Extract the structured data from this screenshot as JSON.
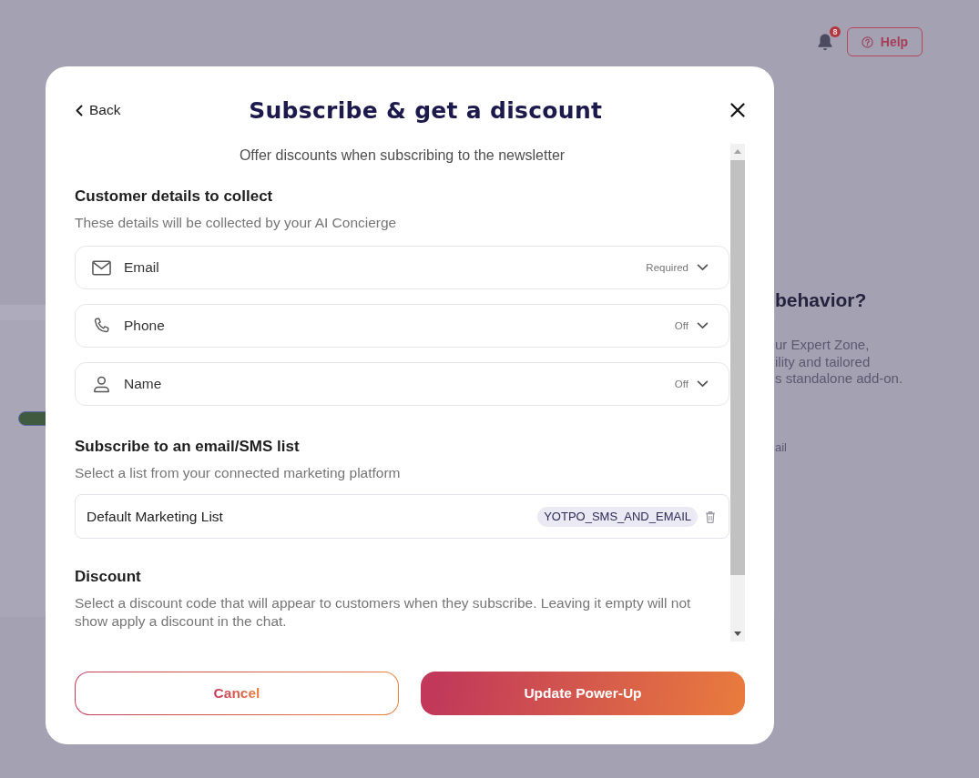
{
  "top_bar": {
    "notification_count": "8",
    "help_button": {
      "label": "Help"
    }
  },
  "side_panel": {
    "heading": "behavior?",
    "description_lines": [
      "ur Expert Zone,",
      "ility and tailored",
      "s standalone add-on."
    ],
    "note": "ail"
  },
  "modal": {
    "back_label": "Back",
    "title": "Subscribe & get a discount",
    "subtitle": "Offer discounts when subscribing to the newsletter",
    "sections": [
      {
        "kind": "fields",
        "heading": "Customer details to collect",
        "description": "These details will be collected by your AI Concierge",
        "items": [
          {
            "kind": "email",
            "label": "Email",
            "status": "Required",
            "expanded": false
          },
          {
            "kind": "phone",
            "label": "Phone",
            "status": "Off",
            "expanded": false
          },
          {
            "kind": "name",
            "label": "Name",
            "status": "Off",
            "expanded": false
          }
        ]
      },
      {
        "kind": "lists",
        "heading": "Subscribe to an email/SMS list",
        "description": "Select a list from your connected marketing platform",
        "items": [
          {
            "label": "Default Marketing List",
            "tag": "YOTPO_SMS_AND_EMAIL"
          }
        ]
      },
      {
        "kind": "discount",
        "heading": "Discount",
        "description": "Select a discount code that will appear to customers when they subscribe. Leaving it empty will not show apply a discount in the chat."
      }
    ],
    "buttons": [
      {
        "kind": "secondary",
        "label": "Cancel"
      },
      {
        "kind": "primary",
        "label": "Update Power-Up"
      }
    ]
  }
}
